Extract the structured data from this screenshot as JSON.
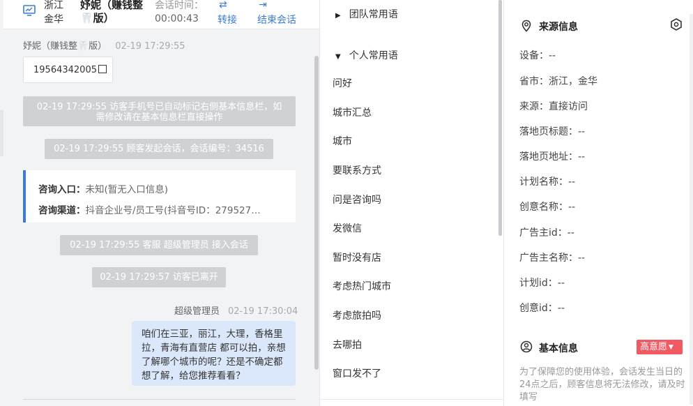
{
  "header": {
    "location": "浙江金华",
    "visitor_name": "妤妮（赚钱整🦷版）",
    "time_label": "会话时间：",
    "time_value": "00:00:43",
    "transfer_label": "转接",
    "end_label": "结束会话"
  },
  "chat": {
    "visitor_meta_name": "妤妮（赚钱整🦷版）",
    "visitor_meta_time": "02-19 17:29:55",
    "phone": "19564342005",
    "sys1": "02-19 17:29:55 访客手机号已自动标记右侧基本信息栏，如需修改请在基本信息栏直接操作",
    "sys2": "02-19 17:29:55 顾客发起会话，会话编号：34516",
    "entry_label": "咨询入口：",
    "entry_value": "未知(暂无入口信息)",
    "channel_label": "咨询渠道：",
    "channel_value": "抖音企业号/员工号(抖音号ID：279527…",
    "sys3": "02-19 17:29:55 客服 超级管理员 接入会话",
    "sys4": "02-19 17:29:57 访客已离开",
    "agent_name": "超级管理员",
    "agent_time": "02-19 17:30:04",
    "agent_message": "咱们在三亚，丽江，大理，香格里拉，青海有直营店 都可以拍，亲想了解哪个城市的呢？还是不确定都想了解，给您推荐看看？"
  },
  "phrases": {
    "team_group": "团队常用语",
    "personal_group": "个人常用语",
    "items": [
      "问好",
      "城市汇总",
      "城市",
      "要联系方式",
      "问是咨询吗",
      "发微信",
      "暂时没有店",
      "考虑热门城市",
      "考虑旅拍吗",
      "去哪拍",
      "窗口发不了"
    ]
  },
  "source": {
    "title": "来源信息",
    "fields": [
      "设备：--",
      "省市：浙江，金华",
      "来源：直接访问",
      "落地页标题：--",
      "落地页地址：--",
      "计划名称：--",
      "创意名称：--",
      "广告主id：--",
      "广告主名称：--",
      "计划id：--",
      "创意id：--"
    ]
  },
  "basic": {
    "title": "基本信息",
    "intent_tag": "高意愿",
    "notice": "为了保障您的使用体验，会话发生当日的24点之后，顾客信息将无法修改，请及时填写"
  },
  "colors": {
    "accent": "#3a7bd5",
    "tag": "#f25a63",
    "bubble": "#dbe8fb",
    "system": "#cfd1d4"
  },
  "icons": [
    "monitor-icon",
    "transfer-icon",
    "exit-icon",
    "copy-icon",
    "location-pin-icon",
    "settings-hex-icon",
    "user-circle-icon",
    "caret-right-icon",
    "caret-down-icon"
  ]
}
